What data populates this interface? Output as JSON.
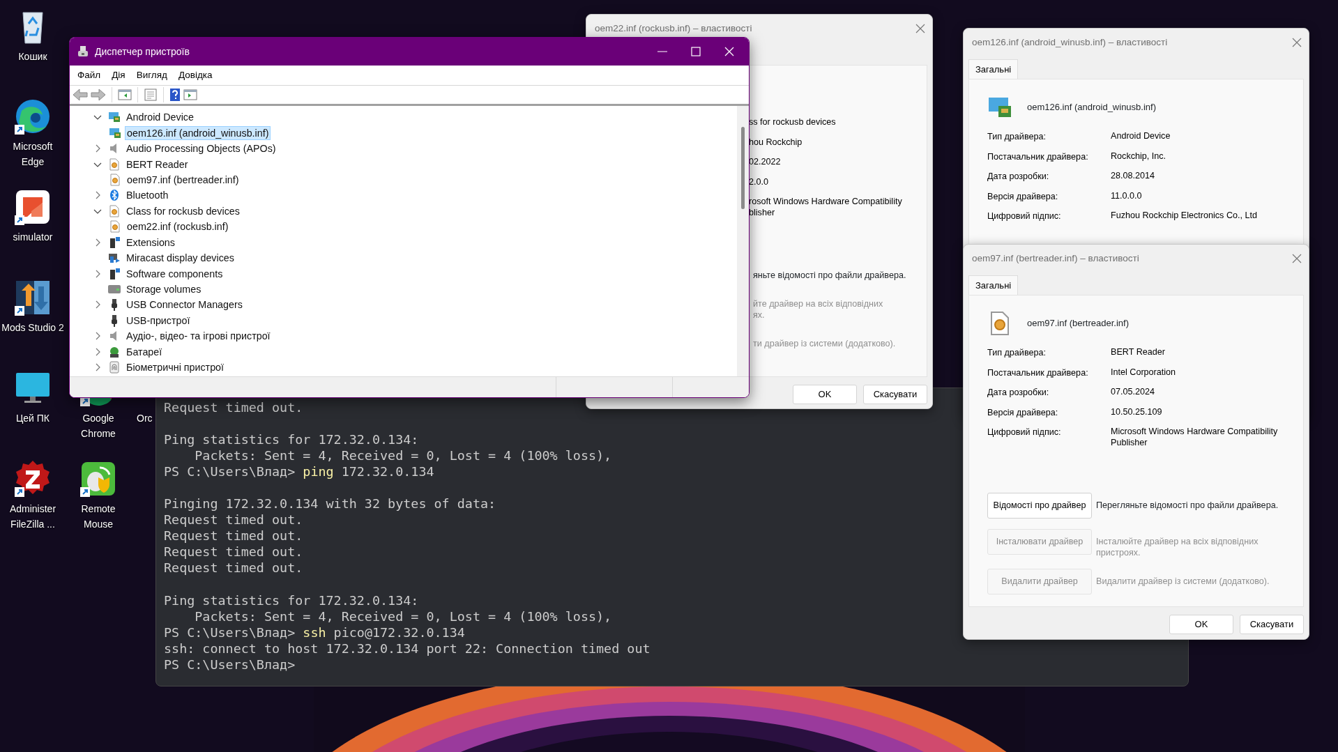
{
  "desktop": {
    "icons": [
      {
        "label": "Кошик",
        "kind": "recycle-bin",
        "shortcut": false
      },
      {
        "label": "Microsoft Edge",
        "kind": "edge",
        "shortcut": true
      },
      {
        "label": "simulator",
        "kind": "simulator",
        "shortcut": true
      },
      {
        "label": "Mods Studio 2",
        "kind": "mods",
        "shortcut": true
      },
      {
        "label": "Цей ПК",
        "kind": "monitor",
        "shortcut": false
      },
      {
        "label": "Administer FileZilla ...",
        "kind": "filezilla",
        "shortcut": true
      },
      {
        "label": "Google Chrome",
        "kind": "chrome",
        "shortcut": true
      },
      {
        "label": "Orc",
        "kind": "covered"
      },
      {
        "label": "Remote Mouse",
        "kind": "remote-mouse",
        "shortcut": true
      }
    ]
  },
  "terminal": {
    "lines": [
      {
        "kind": "output",
        "text": "Request timed out."
      },
      {
        "kind": "blank"
      },
      {
        "kind": "output",
        "text": "Ping statistics for 172.32.0.134:"
      },
      {
        "kind": "output",
        "text": "    Packets: Sent = 4, Received = 0, Lost = 4 (100% loss),"
      },
      {
        "kind": "command",
        "prompt": "PS C:\\Users\\Влад>",
        "command": "ping",
        "args": "172.32.0.134"
      },
      {
        "kind": "blank"
      },
      {
        "kind": "output",
        "text": "Pinging 172.32.0.134 with 32 bytes of data:"
      },
      {
        "kind": "output",
        "text": "Request timed out."
      },
      {
        "kind": "output",
        "text": "Request timed out."
      },
      {
        "kind": "output",
        "text": "Request timed out."
      },
      {
        "kind": "output",
        "text": "Request timed out."
      },
      {
        "kind": "blank"
      },
      {
        "kind": "output",
        "text": "Ping statistics for 172.32.0.134:"
      },
      {
        "kind": "output",
        "text": "    Packets: Sent = 4, Received = 0, Lost = 4 (100% loss),"
      },
      {
        "kind": "command",
        "prompt": "PS C:\\Users\\Влад>",
        "command": "ssh",
        "args": "pico@172.32.0.134"
      },
      {
        "kind": "output",
        "text": "ssh: connect to host 172.32.0.134 port 22: Connection timed out"
      },
      {
        "kind": "prompt",
        "prompt": "PS C:\\Users\\Влад>"
      }
    ]
  },
  "properties_windows": [
    {
      "title": "oem22.inf (rockusb.inf) – властивості",
      "fields": [
        {
          "value": "ss for rockusb devices"
        },
        {
          "value": "hou Rockchip"
        },
        {
          "value": "02.2022"
        },
        {
          "value": "2.0.0"
        },
        {
          "value": "rosoft Windows Hardware Compatibility\nblisher"
        }
      ],
      "actions": [
        {
          "description": "яньте відомості про файли драйвера.",
          "disabled": false
        },
        {
          "description": "йте драйвер на всіх відповідних\nях.",
          "disabled": true
        },
        {
          "description": "ти драйвер із системи (додатково).",
          "disabled": true
        }
      ],
      "buttons": [
        "OK",
        "Скасувати"
      ]
    },
    {
      "title": "oem126.inf (android_winusb.inf) – властивості",
      "tabs": [
        {
          "label": "Загальні",
          "selected": true
        }
      ],
      "kind": "monitor-board",
      "driver_name": "oem126.inf (android_winusb.inf)",
      "fields": [
        {
          "label": "Тип драйвера:",
          "value": "Android Device"
        },
        {
          "label": "Постачальник драйвера:",
          "value": "Rockchip, Inc."
        },
        {
          "label": "Дата розробки:",
          "value": "28.08.2014"
        },
        {
          "label": "Версія драйвера:",
          "value": "11.0.0.0"
        },
        {
          "label": "Цифровий підпис:",
          "value": "Fuzhou Rockchip Electronics Co., Ltd"
        }
      ]
    },
    {
      "title": "oem97.inf (bertreader.inf) – властивості",
      "tabs": [
        {
          "label": "Загальні",
          "selected": true
        }
      ],
      "kind": "gear-file",
      "driver_name": "oem97.inf (bertreader.inf)",
      "fields": [
        {
          "label": "Тип драйвера:",
          "value": "BERT Reader"
        },
        {
          "label": "Постачальник драйвера:",
          "value": "Intel Corporation"
        },
        {
          "label": "Дата розробки:",
          "value": "07.05.2024"
        },
        {
          "label": "Версія драйвера:",
          "value": "10.50.25.109"
        },
        {
          "label": "Цифровий підпис:",
          "value": "Microsoft Windows Hardware Compatibility\nPublisher"
        }
      ],
      "actions": [
        {
          "button": "Відомості про драйвер",
          "description": "Перегляньте відомості про файли драйвера.",
          "disabled": false
        },
        {
          "button": "Інсталювати драйвер",
          "description": "Інсталюйте драйвер на всіх відповідних\nпристроях.",
          "disabled": true
        },
        {
          "button": "Видалити драйвер",
          "description": "Видалити драйвер із системи (додатково).",
          "disabled": true
        }
      ],
      "buttons": [
        "OK",
        "Скасувати"
      ]
    }
  ],
  "device_manager": {
    "title": "Диспетчер пристроїв",
    "menu": [
      "Файл",
      "Дія",
      "Вигляд",
      "Довідка"
    ],
    "tree": [
      {
        "label": "Android Device",
        "kind": "monitor-board",
        "expandable": true,
        "expanded": true,
        "children": [
          {
            "label": "oem126.inf (android_winusb.inf)",
            "kind": "monitor-board",
            "selected": true
          }
        ]
      },
      {
        "label": "Audio Processing Objects (APOs)",
        "kind": "speaker",
        "expandable": true,
        "expanded": false
      },
      {
        "label": "BERT Reader",
        "kind": "gear-file",
        "expandable": true,
        "expanded": true,
        "children": [
          {
            "label": "oem97.inf (bertreader.inf)",
            "kind": "gear-file",
            "selected": false
          }
        ]
      },
      {
        "label": "Bluetooth",
        "kind": "bluetooth",
        "expandable": true,
        "expanded": false
      },
      {
        "label": "Class for rockusb devices",
        "kind": "gear-file",
        "expandable": true,
        "expanded": true,
        "children": [
          {
            "label": "oem22.inf (rockusb.inf)",
            "kind": "gear-file",
            "selected": false
          }
        ]
      },
      {
        "label": "Extensions",
        "kind": "tower",
        "expandable": true,
        "expanded": false
      },
      {
        "label": "Miracast display devices",
        "kind": "miracast",
        "expandable": false
      },
      {
        "label": "Software components",
        "kind": "tower",
        "expandable": true,
        "expanded": false
      },
      {
        "label": "Storage volumes",
        "kind": "drive",
        "expandable": false
      },
      {
        "label": "USB Connector Managers",
        "kind": "usb",
        "expandable": true,
        "expanded": false
      },
      {
        "label": "USB-пристрої",
        "kind": "usb",
        "expandable": false
      },
      {
        "label": "Аудіо-, відео- та ігрові пристрої",
        "kind": "speaker",
        "expandable": true,
        "expanded": false
      },
      {
        "label": "Батареї",
        "kind": "battery",
        "expandable": true,
        "expanded": false
      },
      {
        "label": "Біометричні пристрої",
        "kind": "fingerprint",
        "expandable": true,
        "expanded": false
      }
    ]
  }
}
